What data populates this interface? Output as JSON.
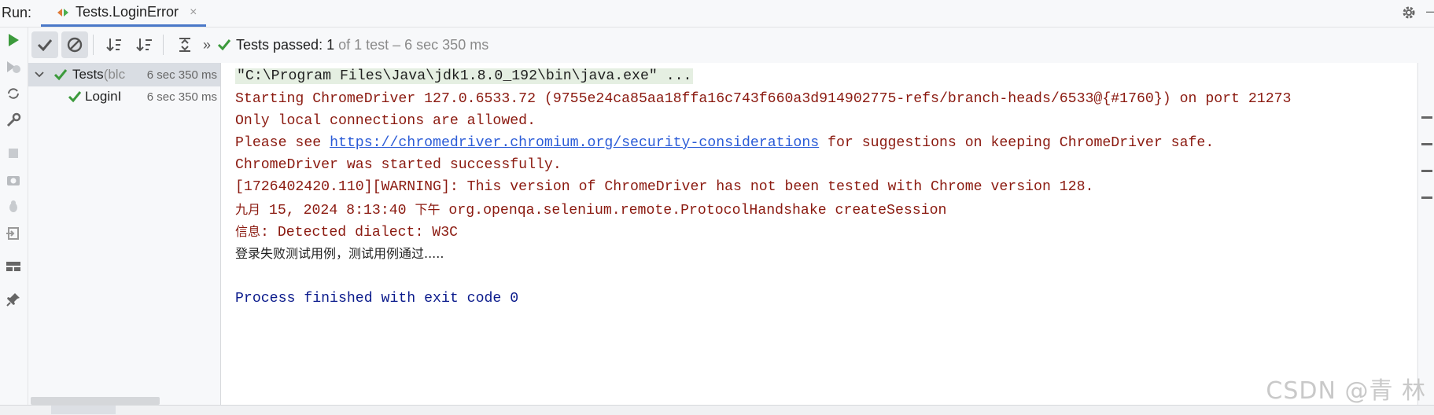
{
  "run_bar": {
    "label": "Run:",
    "tab_title": "Tests.LoginError",
    "tab_close": "×"
  },
  "toolbar": {
    "status_main": "Tests passed: 1",
    "status_sub": " of 1 test – 6 sec 350 ms",
    "overflow": "»"
  },
  "tree": {
    "items": [
      {
        "name": "Tests",
        "detail": " (blc",
        "time": "6 sec 350 ms"
      },
      {
        "name": "LoginI",
        "time": "6 sec 350 ms"
      }
    ]
  },
  "console": {
    "line1": "\"C:\\Program Files\\Java\\jdk1.8.0_192\\bin\\java.exe\" ...",
    "line2": "Starting ChromeDriver 127.0.6533.72 (9755e24ca85aa18ffa16c743f660a3d914902775-refs/branch-heads/6533@{#1760}) on port 21273",
    "line3": "Only local connections are allowed.",
    "line4_prefix": "Please see ",
    "line4_link": "https://chromedriver.chromium.org/security-considerations",
    "line4_suffix": " for suggestions on keeping ChromeDriver safe.",
    "line5": "ChromeDriver was started successfully.",
    "line6": "[1726402420.110][WARNING]: This version of ChromeDriver has not been tested with Chrome version 128.",
    "line7_month": "九月",
    "line7_date": " 15, 2024 8:13:40 ",
    "line7_ampm": "下午",
    "line7_rest": " org.openqa.selenium.remote.ProtocolHandshake createSession",
    "line8_label": "信息",
    "line8_rest": ": Detected dialect: W3C",
    "line9": "登录失败测试用例，测试用例通过.....",
    "line10": "Process finished with exit code 0"
  },
  "watermark": "CSDN @青  林",
  "colors": {
    "pass_green": "#3c9a3c",
    "error_red": "#8b1a10",
    "exit_blue": "#0b1b8c",
    "link_blue": "#2a5bd7"
  }
}
